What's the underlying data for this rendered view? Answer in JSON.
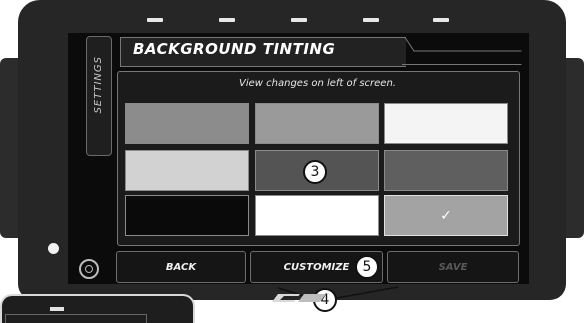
{
  "header": {
    "tab_label": "SETTINGS",
    "title": "BACKGROUND TINTING"
  },
  "content": {
    "caption": "View changes on left of screen.",
    "swatches": [
      {
        "color": "#8c8c8c",
        "selected": false
      },
      {
        "color": "#9a9a9a",
        "selected": false
      },
      {
        "color": "#f4f4f4",
        "selected": false
      },
      {
        "color": "#d2d2d2",
        "selected": false
      },
      {
        "color": "#545454",
        "selected": false
      },
      {
        "color": "#5f5f5f",
        "selected": false
      },
      {
        "color": "#0a0a0a",
        "selected": false
      },
      {
        "color": "#ffffff",
        "selected": false
      },
      {
        "color": "#a3a3a3",
        "selected": true
      }
    ],
    "selected_mark": "✓"
  },
  "buttons": {
    "back": "BACK",
    "customize": "CUSTOMIZE",
    "save": "SAVE"
  },
  "callouts": {
    "grid": "3",
    "buttons": "4",
    "customize": "5"
  },
  "colors": {
    "save_disabled_text": "#5a5a5a",
    "accent_white": "#ffffff"
  }
}
